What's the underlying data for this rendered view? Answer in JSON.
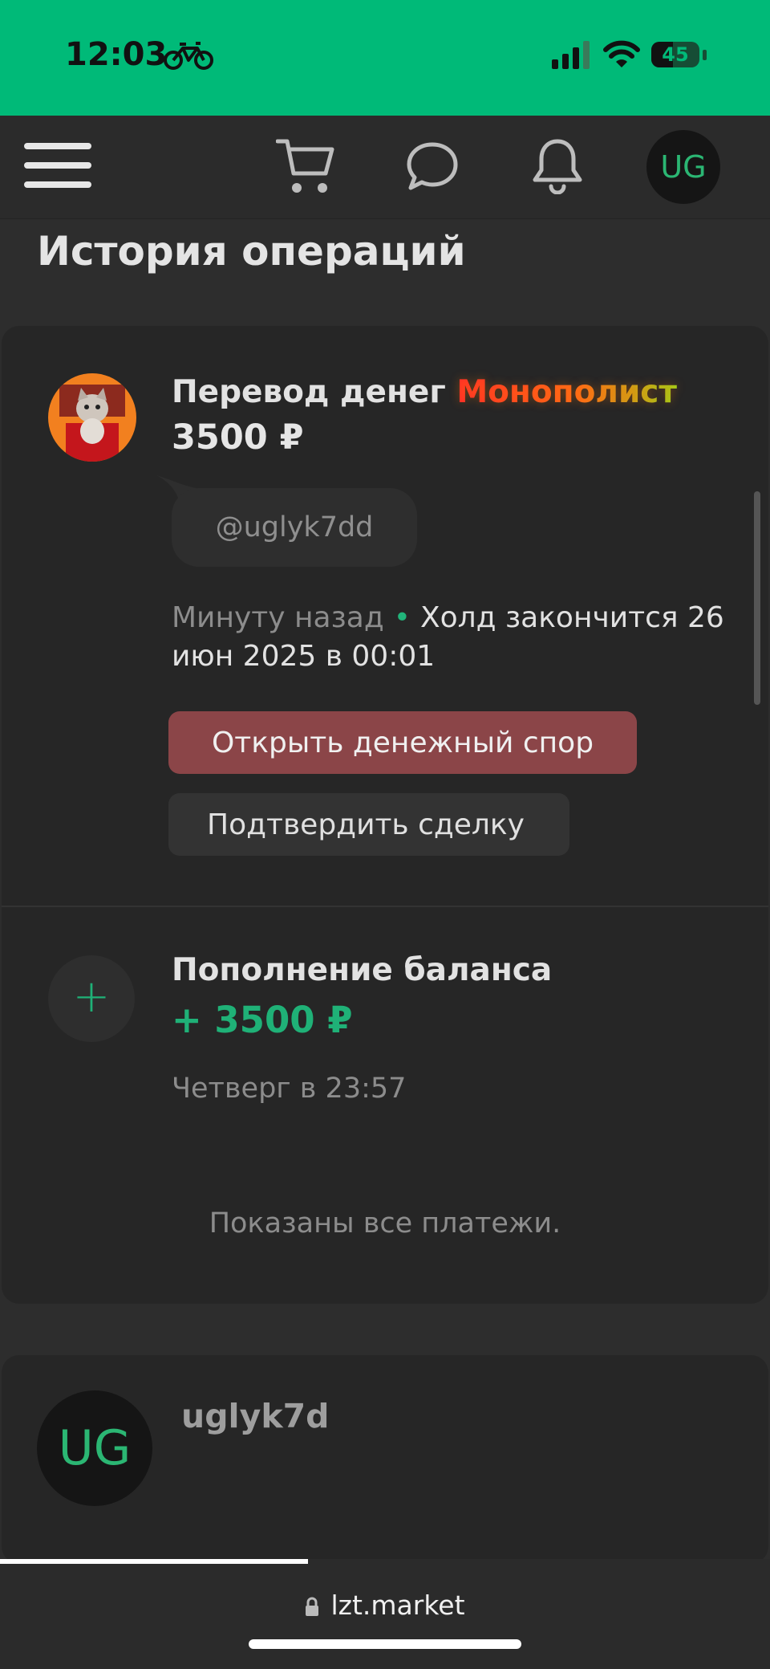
{
  "status_bar": {
    "time": "12:03",
    "battery_level": "45",
    "battery_fraction": 0.45,
    "icons": [
      "bicycle-icon",
      "cellular-signal-icon",
      "wifi-icon",
      "battery-icon"
    ]
  },
  "nav": {
    "icons": [
      "menu-icon",
      "cart-icon",
      "chat-icon",
      "bell-icon"
    ],
    "avatar_initials": "UG",
    "avatar_text_color": "#2bb673"
  },
  "page": {
    "title": "История операций"
  },
  "transactions": [
    {
      "title": "Перевод денег",
      "badge": "Монополист",
      "amount": "3500 ₽",
      "comment": "@uglyk7dd",
      "time": "Минуту назад",
      "hold_text": "Холд закончится 26 июн 2025 в 00:01",
      "actions": {
        "dispute": "Открыть денежный спор",
        "confirm": "Подтвердить сделку"
      }
    },
    {
      "title": "Пополнение баланса",
      "amount": "+ 3500 ₽",
      "time": "Четверг в 23:57"
    }
  ],
  "footer_note": "Показаны все платежи.",
  "profile": {
    "initials": "UG",
    "username": "uglyk7d"
  },
  "browser": {
    "url": "lzt.market",
    "load_progress": 0.4
  },
  "colors": {
    "accent_green": "#00ba78",
    "dispute_button": "#8b4548",
    "positive_amount": "#1fb177"
  }
}
